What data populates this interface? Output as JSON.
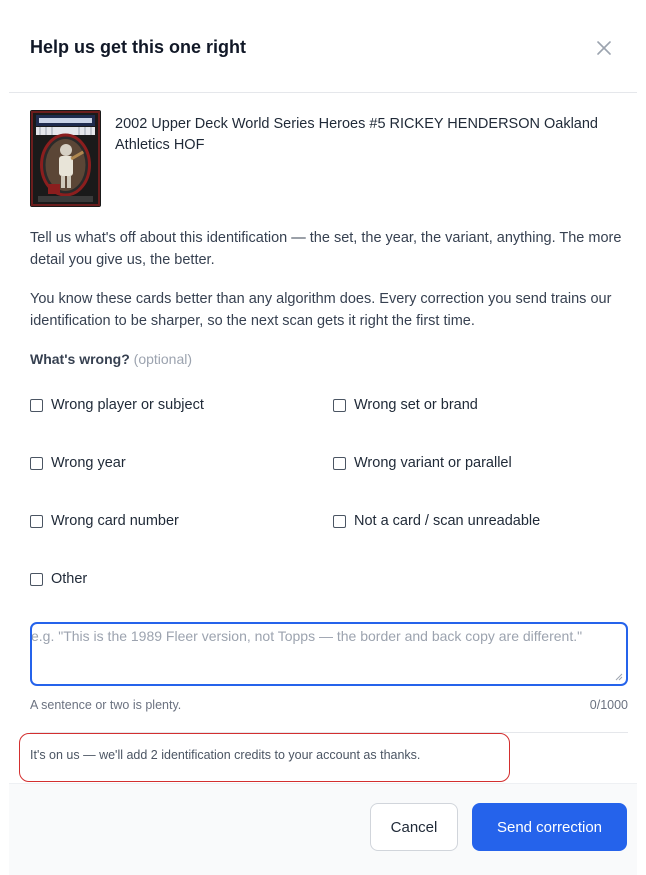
{
  "dialog": {
    "title": "Help us get this one right",
    "close_icon": "close-icon"
  },
  "card": {
    "thumbnail_icon": "baseball-card-thumbnail",
    "title": "2002 Upper Deck World Series Heroes #5 RICKEY HENDERSON Oakland Athletics HOF"
  },
  "intro": {
    "paragraph_1": "Tell us what's off about this identification — the set, the year, the variant, anything. The more detail you give us, the better.",
    "paragraph_2": "You know these cards better than any algorithm does. Every correction you send trains our identification to be sharper, so the next scan gets it right the first time."
  },
  "question": {
    "label": "What's wrong?",
    "optional": "(optional)",
    "options": [
      {
        "label": "Wrong player or subject",
        "checked": false
      },
      {
        "label": "Wrong set or brand",
        "checked": false
      },
      {
        "label": "Wrong year",
        "checked": false
      },
      {
        "label": "Wrong variant or parallel",
        "checked": false
      },
      {
        "label": "Wrong card number",
        "checked": false
      },
      {
        "label": "Not a card / scan unreadable",
        "checked": false
      },
      {
        "label": "Other",
        "checked": false
      }
    ]
  },
  "details": {
    "value": "",
    "placeholder": "e.g. \"This is the 1989 Fleer version, not Topps — the border and back copy are different.\"",
    "hint": "A sentence or two is plenty.",
    "counter": "0/1000"
  },
  "credits": {
    "text": "It's on us — we'll add 2 identification credits to your account as thanks."
  },
  "footer": {
    "cancel_label": "Cancel",
    "send_label": "Send correction"
  },
  "colors": {
    "accent": "#2563eb",
    "highlight_border": "#d32f2f"
  }
}
